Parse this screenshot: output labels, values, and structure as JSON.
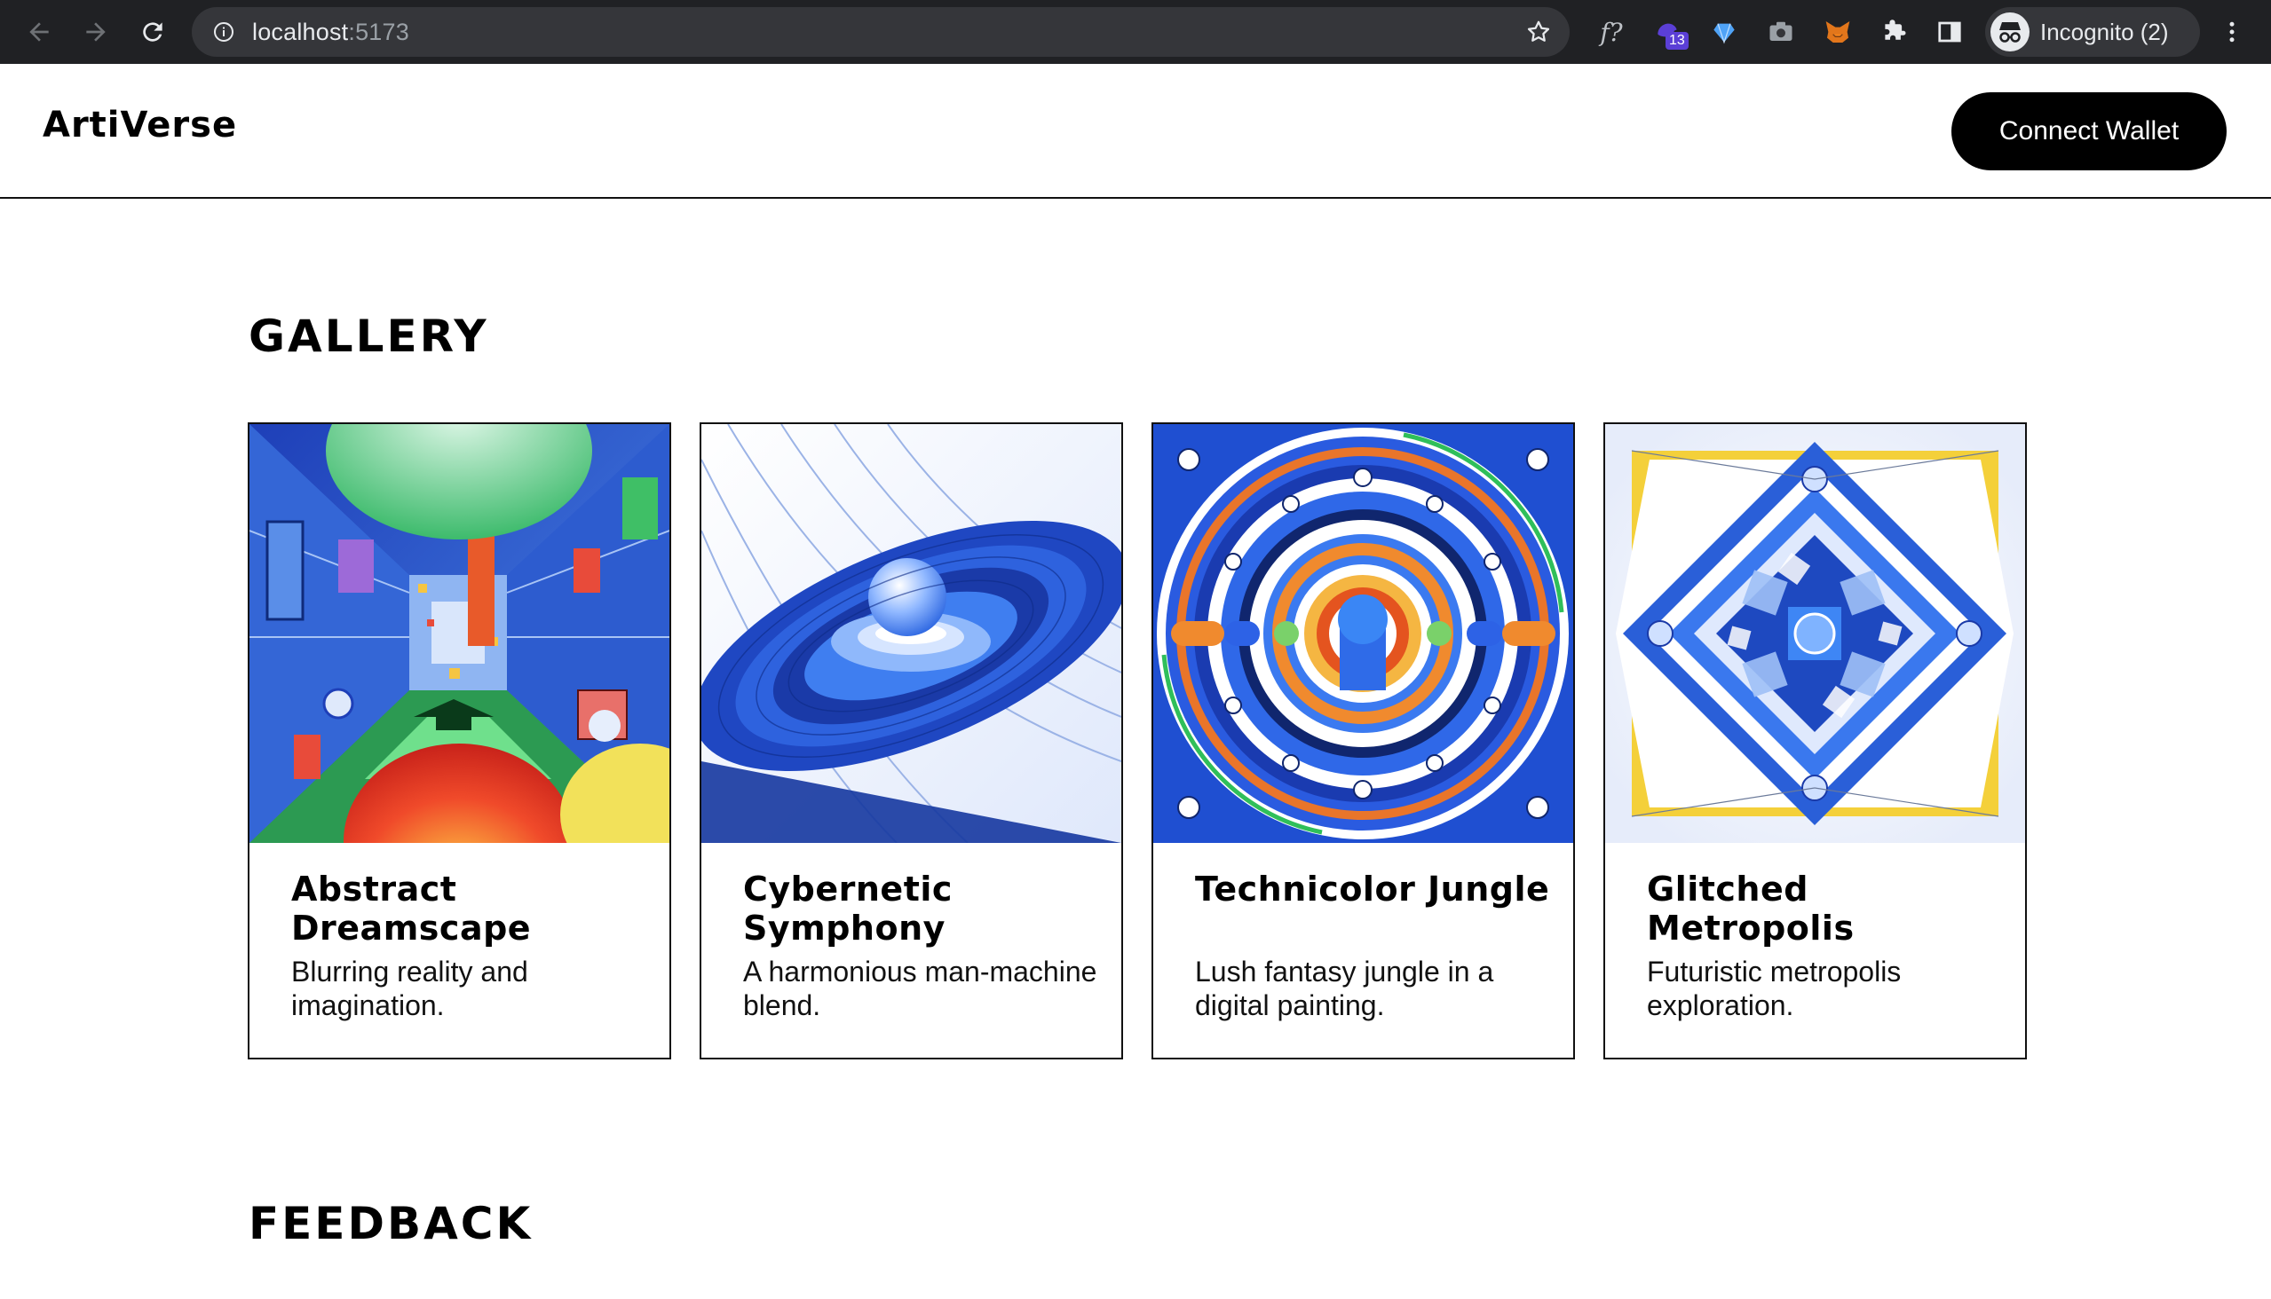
{
  "browser": {
    "url_host": "localhost",
    "url_port": ":5173",
    "extension_badge": "13",
    "profile_label": "Incognito (2)"
  },
  "header": {
    "logo": "ArtiVerse",
    "connect_label": "Connect Wallet"
  },
  "gallery": {
    "title": "GALLERY",
    "cards": [
      {
        "title": "Abstract Dreamscape",
        "desc": "Blurring reality and imagination."
      },
      {
        "title": "Cybernetic Symphony",
        "desc": "A harmonious man-machine blend."
      },
      {
        "title": "Technicolor Jungle",
        "desc": "Lush fantasy jungle in a digital painting."
      },
      {
        "title": "Glitched Metropolis",
        "desc": "Futuristic metropolis exploration."
      }
    ]
  },
  "feedback": {
    "title": "FEEDBACK"
  }
}
